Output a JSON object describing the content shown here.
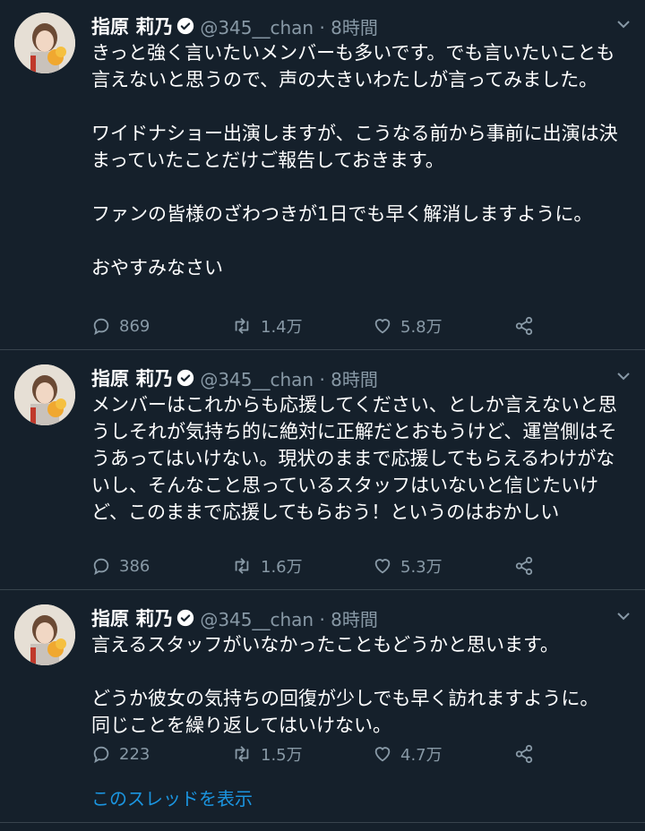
{
  "tweets": [
    {
      "name": "指原 莉乃",
      "handle": "@345__chan · 8時間",
      "text": "きっと強く言いたいメンバーも多いです。でも言いたいことも言えないと思うので、声の大きいわたしが言ってみました。\n\nワイドナショー出演しますが、こうなる前から事前に出演は決まっていたことだけご報告しておきます。\n\nファンの皆様のざわつきが1日でも早く解消しますように。\n\nおやすみなさい",
      "replies": "869",
      "retweets": "1.4万",
      "likes": "5.8万"
    },
    {
      "name": "指原 莉乃",
      "handle": "@345__chan · 8時間",
      "text": "メンバーはこれからも応援してください、としか言えないと思うしそれが気持ち的に絶対に正解だとおもうけど、運営側はそうあってはいけない。現状のままで応援してもらえるわけがないし、そんなこと思っているスタッフはいないと信じたいけど、このままで応援してもらおう！というのはおかしい",
      "replies": "386",
      "retweets": "1.6万",
      "likes": "5.3万"
    },
    {
      "name": "指原 莉乃",
      "handle": "@345__chan · 8時間",
      "text": "言えるスタッフがいなかったこともどうかと思います。\n\nどうか彼女の気持ちの回復が少しでも早く訪れますように。\n同じことを繰り返してはいけない。",
      "replies": "223",
      "retweets": "1.5万",
      "likes": "4.7万"
    }
  ],
  "thread_link": "このスレッドを表示",
  "icons": {
    "verified": "verified-badge-icon",
    "reply": "reply-icon",
    "retweet": "retweet-icon",
    "like": "heart-icon",
    "share": "share-icon",
    "more": "chevron-down-icon"
  },
  "colors": {
    "background": "#15202b",
    "text": "#ffffff",
    "muted": "#8899a6",
    "link": "#1b95e0",
    "divider": "#38444d"
  }
}
